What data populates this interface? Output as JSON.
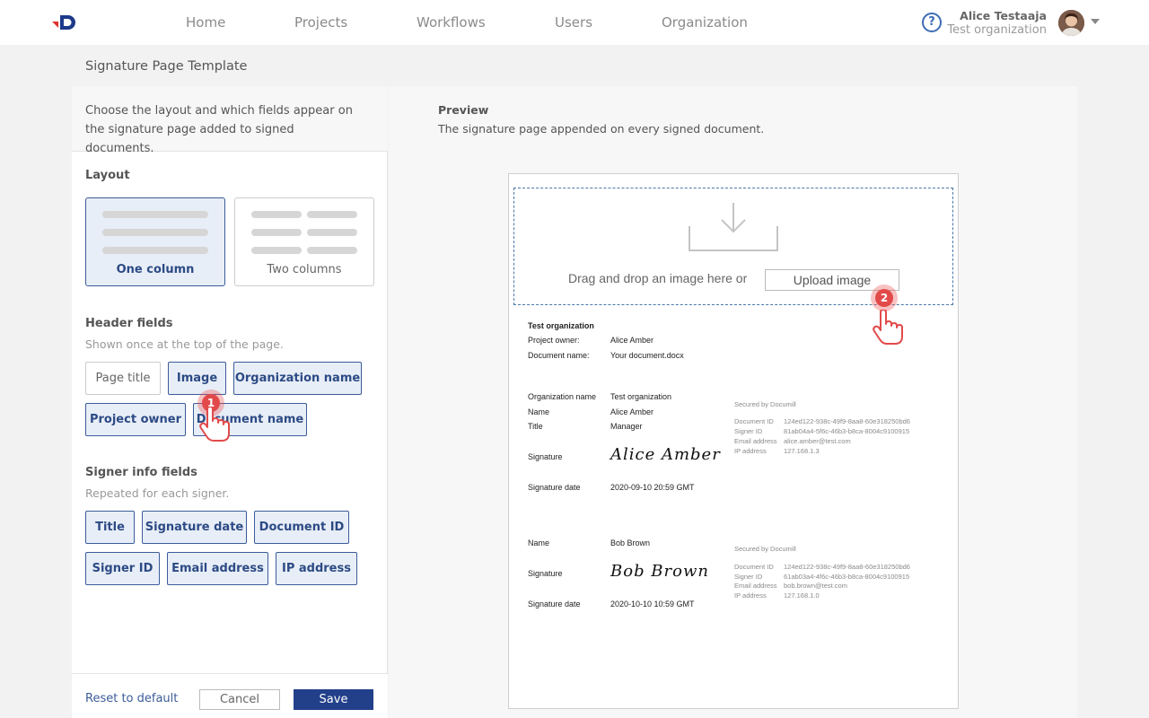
{
  "nav": {
    "items": [
      "Home",
      "Projects",
      "Workflows",
      "Users",
      "Organization"
    ],
    "user_name": "Alice Testaaja",
    "user_org": "Test organization",
    "help_symbol": "?"
  },
  "page": {
    "title": "Signature Page Template"
  },
  "left": {
    "intro": "Choose the layout and which fields appear on the signature page added to signed documents.",
    "layout_title": "Layout",
    "layout_options": [
      {
        "label": "One column",
        "selected": true
      },
      {
        "label": "Two columns",
        "selected": false
      }
    ],
    "header_title": "Header fields",
    "header_sub": "Shown once at the top of the page.",
    "header_fields": [
      {
        "label": "Page title",
        "selected": false
      },
      {
        "label": "Image",
        "selected": true
      },
      {
        "label": "Organization name",
        "selected": true
      },
      {
        "label": "Project owner",
        "selected": true
      },
      {
        "label": "Document name",
        "selected": true
      }
    ],
    "signer_title": "Signer info fields",
    "signer_sub": "Repeated for each signer.",
    "signer_fields": [
      {
        "label": "Title",
        "selected": true
      },
      {
        "label": "Signature date",
        "selected": true
      },
      {
        "label": "Document ID",
        "selected": true
      },
      {
        "label": "Signer ID",
        "selected": true
      },
      {
        "label": "Email address",
        "selected": true
      },
      {
        "label": "IP address",
        "selected": true
      }
    ],
    "reset_label": "Reset to default",
    "cancel_label": "Cancel",
    "save_label": "Save"
  },
  "preview": {
    "title": "Preview",
    "subtitle": "The signature page appended on every signed document.",
    "drop_text": "Drag and drop an image here or",
    "upload_label": "Upload image",
    "header": {
      "org": "Test organization",
      "owner_label": "Project owner:",
      "owner_value": "Alice Amber",
      "doc_label": "Document name:",
      "doc_value": "Your document.docx"
    },
    "signers": [
      {
        "rows": [
          {
            "label": "Organization name",
            "value": "Test organization"
          },
          {
            "label": "Name",
            "value": "Alice Amber"
          },
          {
            "label": "Title",
            "value": "Manager"
          }
        ],
        "signature_label": "Signature",
        "signature": "Alice Amber",
        "date_label": "Signature date",
        "date": "2020-09-10 20:59 GMT",
        "secured": "Secured by Documill",
        "meta": [
          {
            "label": "Document ID",
            "value": "124ed122-938c-49f9-8aa8-60e318250bd6"
          },
          {
            "label": "Signer ID",
            "value": "81ab04a4-5f6c-46b3-b8ca-8004c9100915"
          },
          {
            "label": "Email address",
            "value": "alice.amber@test.com"
          },
          {
            "label": "IP address",
            "value": "127.168.1.3"
          }
        ]
      },
      {
        "rows": [
          {
            "label": "Name",
            "value": "Bob Brown"
          }
        ],
        "signature_label": "Signature",
        "signature": "Bob Brown",
        "date_label": "Signature date",
        "date": "2020-10-10 10:59 GMT",
        "secured": "Secured by Documill",
        "meta": [
          {
            "label": "Document ID",
            "value": "124ed122-938c-49f9-8aa8-60e318250bd6"
          },
          {
            "label": "Signer ID",
            "value": "61ab03a4-4f6c-46b3-b8ca-8004c9100915"
          },
          {
            "label": "Email address",
            "value": "bob.brown@test.com"
          },
          {
            "label": "IP address",
            "value": "127.168.1.0"
          }
        ]
      }
    ]
  },
  "steps": [
    "1",
    "2"
  ],
  "colors": {
    "accent": "#223f8a",
    "selected_bg": "#e8eef7",
    "marker": "#e24a4a",
    "logo_blue": "#1e3a8a",
    "logo_red": "#e0312f"
  },
  "icons": {
    "logo": "brand-logo",
    "help": "help-circle-icon",
    "avatar": "user-avatar",
    "caret": "caret-down-icon",
    "upload": "tray-download-icon",
    "pointer": "hand-pointer-icon"
  }
}
